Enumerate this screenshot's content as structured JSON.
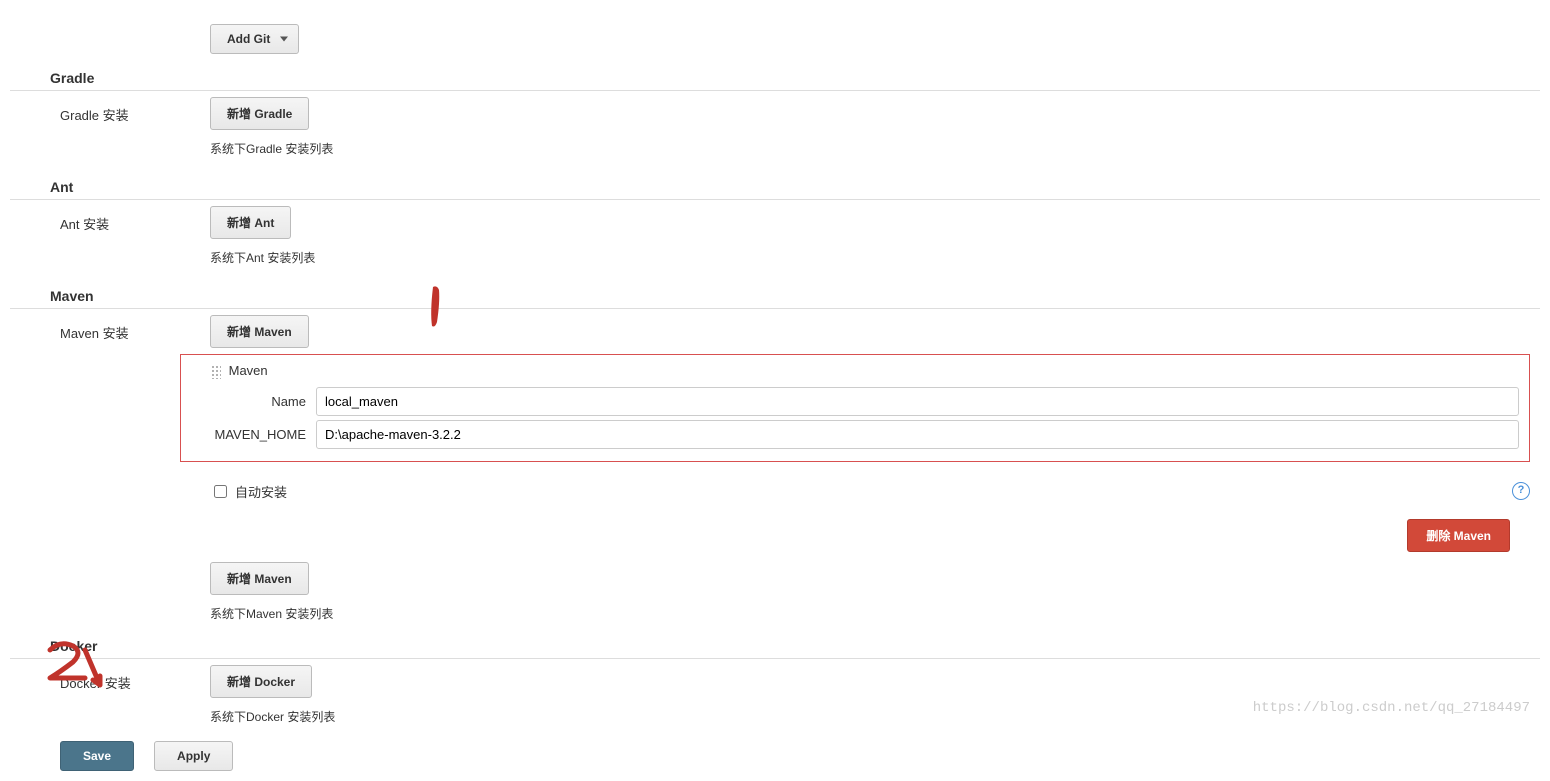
{
  "git": {
    "add_git_label": "Add Git"
  },
  "gradle": {
    "title": "Gradle",
    "install_label": "Gradle 安装",
    "add_button": "新增 Gradle",
    "list_text": "系统下Gradle 安装列表"
  },
  "ant": {
    "title": "Ant",
    "install_label": "Ant 安装",
    "add_button": "新增 Ant",
    "list_text": "系统下Ant 安装列表"
  },
  "maven": {
    "title": "Maven",
    "install_label": "Maven 安装",
    "add_button": "新增 Maven",
    "header": "Maven",
    "name_label": "Name",
    "name_value": "local_maven",
    "home_label": "MAVEN_HOME",
    "home_value": "D:\\apache-maven-3.2.2",
    "auto_install_label": "自动安装",
    "auto_install_checked": false,
    "delete_button": "删除 Maven",
    "add_button2": "新增 Maven",
    "list_text": "系统下Maven 安装列表"
  },
  "docker": {
    "title": "Docker",
    "install_label": "Docker 安装",
    "add_button": "新增 Docker",
    "list_text": "系统下Docker 安装列表"
  },
  "footer": {
    "save_label": "Save",
    "apply_label": "Apply"
  },
  "watermark": "https://blog.csdn.net/qq_27184497",
  "annotations": {
    "one": "1",
    "two": "2"
  }
}
